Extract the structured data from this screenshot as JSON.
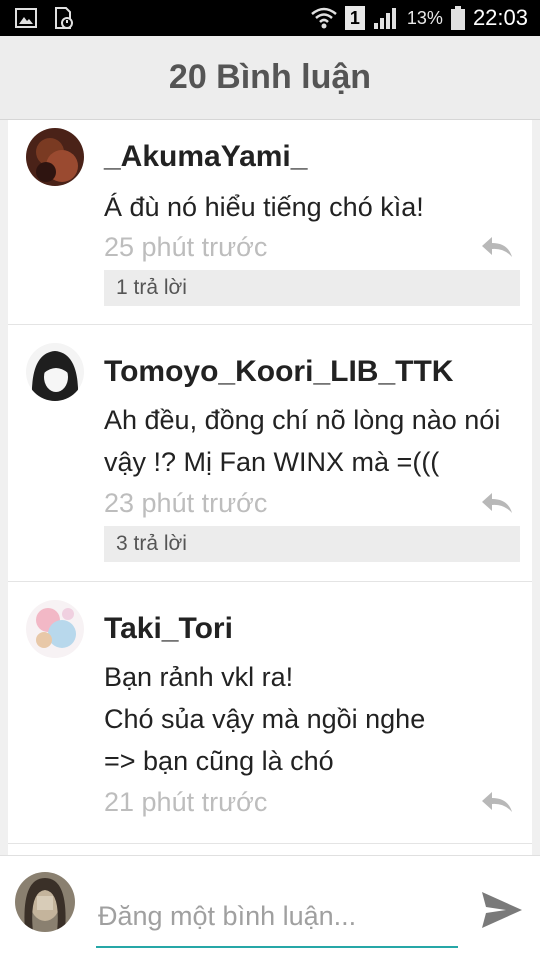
{
  "status_bar": {
    "sim_label": "1",
    "battery": "13%",
    "time": "22:03",
    "icons": [
      "image-icon",
      "sd-card-icon",
      "wifi-icon",
      "sim-icon",
      "signal-icon",
      "battery-icon"
    ]
  },
  "header": {
    "title": "20 Bình luận"
  },
  "comments": [
    {
      "author": "_AkumaYami_",
      "lines": [
        "Á đù nó hiểu tiếng chó kìa!"
      ],
      "time": "25 phút trước",
      "replies": "1 trả lời"
    },
    {
      "author": "Tomoyo_Koori_LIB_TTK",
      "lines": [
        "Ah đều, đồng chí nõ lòng nào nói",
        "vậy !? Mị Fan WINX mà =((("
      ],
      "time": "23 phút trước",
      "replies": "3 trả lời"
    },
    {
      "author": "Taki_Tori",
      "lines": [
        "Bạn rảnh vkl ra!",
        "Chó sủa vậy mà ngồi nghe",
        "=> bạn cũng là chó"
      ],
      "time": "21 phút trước"
    }
  ],
  "composer": {
    "placeholder": "Đăng một bình luận..."
  },
  "colors": {
    "accent": "#26a7a7",
    "header_bg": "#ededed",
    "muted_text": "#bdbdbd"
  }
}
